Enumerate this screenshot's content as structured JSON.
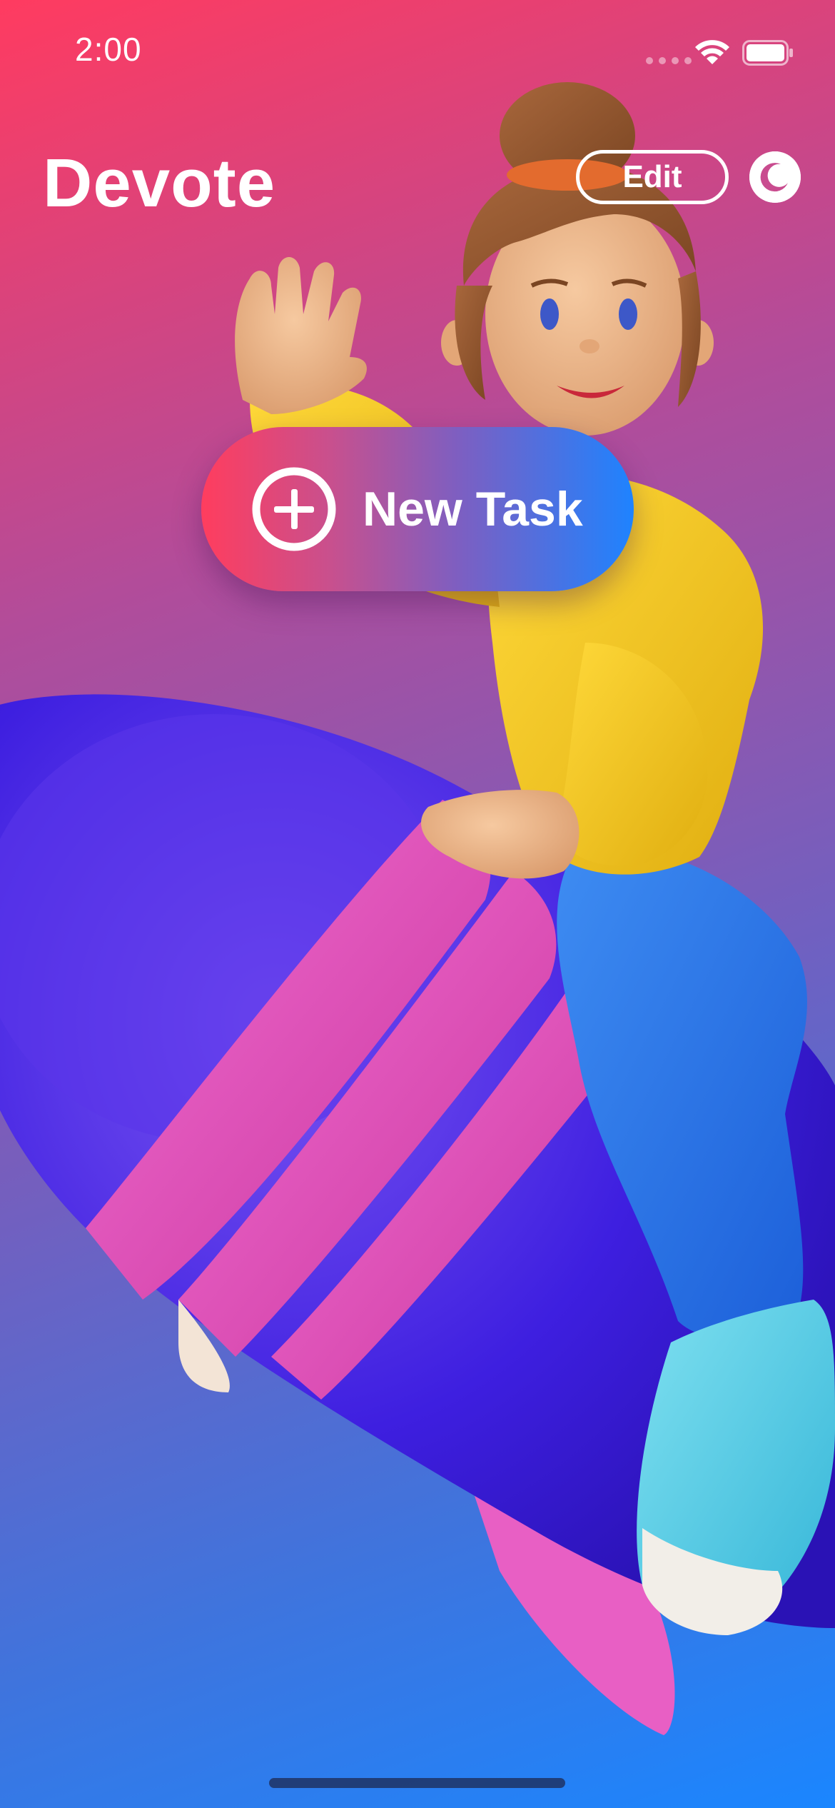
{
  "status_bar": {
    "time": "2:00",
    "icons": [
      "signal-icon",
      "wifi-icon",
      "battery-icon"
    ]
  },
  "header": {
    "title": "Devote",
    "edit_label": "Edit",
    "appearance_icon": "moon-icon"
  },
  "main": {
    "new_task_label": "New Task",
    "new_task_icon": "plus-circle-icon",
    "illustration": "character-riding-rocket-illustration"
  },
  "colors": {
    "gradient_top": "#FF3B60",
    "gradient_bottom": "#1A86FF",
    "button_start": "#FF3D5E",
    "button_end": "#1E83FF",
    "text": "#FFFFFF"
  }
}
